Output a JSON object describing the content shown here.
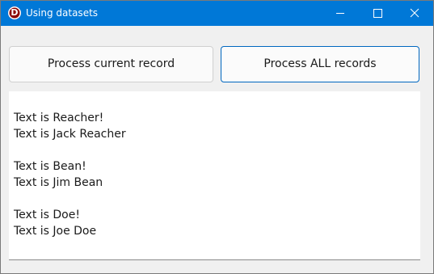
{
  "window": {
    "title": "Using datasets",
    "icon_letter": "D",
    "icon": "delphi-app-icon",
    "caption_icons": [
      "minimize-icon",
      "maximize-icon",
      "close-icon"
    ],
    "accent_color": "#0078d7"
  },
  "buttons": {
    "process_current": "Process current record",
    "process_all": "Process ALL records"
  },
  "memo": {
    "lines": [
      "Text is Reacher!",
      "Text is Jack Reacher",
      "",
      "Text is Bean!",
      "Text is Jim Bean",
      "",
      "Text is Doe!",
      "Text is Joe Doe"
    ]
  }
}
